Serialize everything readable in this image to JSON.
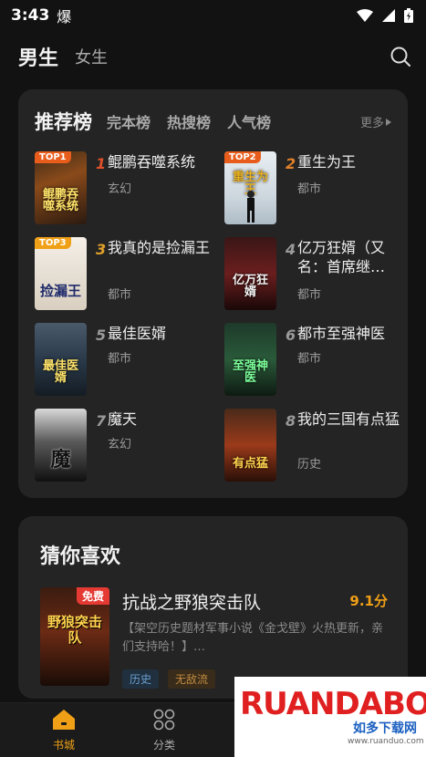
{
  "status_bar": {
    "time": "3:43",
    "notif_glyph": "爆"
  },
  "top_nav": {
    "tabs": [
      {
        "label": "男生"
      },
      {
        "label": "女生"
      }
    ]
  },
  "ranking": {
    "title": "推荐榜",
    "tabs": [
      {
        "label": "完本榜"
      },
      {
        "label": "热搜榜"
      },
      {
        "label": "人气榜"
      }
    ],
    "more_label": "更多",
    "books": [
      {
        "rank": "1",
        "title": "鲲鹏吞噬系统",
        "genre": "玄幻",
        "badge": "TOP1",
        "cover_text": "鲲鹏吞噬系统",
        "rank_color": "#e0502a"
      },
      {
        "rank": "2",
        "title": "重生为王",
        "genre": "都市",
        "badge": "TOP2",
        "cover_text": "重生为王",
        "rank_color": "#e0802a"
      },
      {
        "rank": "3",
        "title": "我真的是捡漏王",
        "genre": "都市",
        "badge": "TOP3",
        "cover_text": "捡漏王",
        "rank_color": "#e0a02a"
      },
      {
        "rank": "4",
        "title": "亿万狂婿（又名：首席继…",
        "genre": "都市",
        "badge": "",
        "cover_text": "亿万狂婿",
        "rank_color": "#9a9a9a"
      },
      {
        "rank": "5",
        "title": "最佳医婿",
        "genre": "都市",
        "badge": "",
        "cover_text": "最佳医婿",
        "rank_color": "#9a9a9a"
      },
      {
        "rank": "6",
        "title": "都市至强神医",
        "genre": "都市",
        "badge": "",
        "cover_text": "至强神医",
        "rank_color": "#9a9a9a"
      },
      {
        "rank": "7",
        "title": "魔天",
        "genre": "玄幻",
        "badge": "",
        "cover_text": "魔",
        "rank_color": "#9a9a9a"
      },
      {
        "rank": "8",
        "title": "我的三国有点猛",
        "genre": "历史",
        "badge": "",
        "cover_text": "有点猛",
        "rank_color": "#9a9a9a"
      }
    ]
  },
  "guess": {
    "title": "猜你喜欢",
    "book": {
      "title": "抗战之野狼突击队",
      "score": "9.1分",
      "badge": "免费",
      "cover_text": "野狼突击队",
      "description": "【架空历史题材军事小说《金戈壁》火热更新，亲们支持哈！】…",
      "tags": [
        {
          "label": "历史"
        },
        {
          "label": "无敌流"
        }
      ]
    }
  },
  "bottom_nav": {
    "items": [
      {
        "label": "书城"
      },
      {
        "label": "分类"
      }
    ]
  },
  "watermark": {
    "letters": "RUANDABO",
    "subtitle": "如多下载网",
    "url": "www.ruanduo.com"
  },
  "colors": {
    "accent": "#f0a016",
    "background": "#121212",
    "card": "#242424"
  }
}
